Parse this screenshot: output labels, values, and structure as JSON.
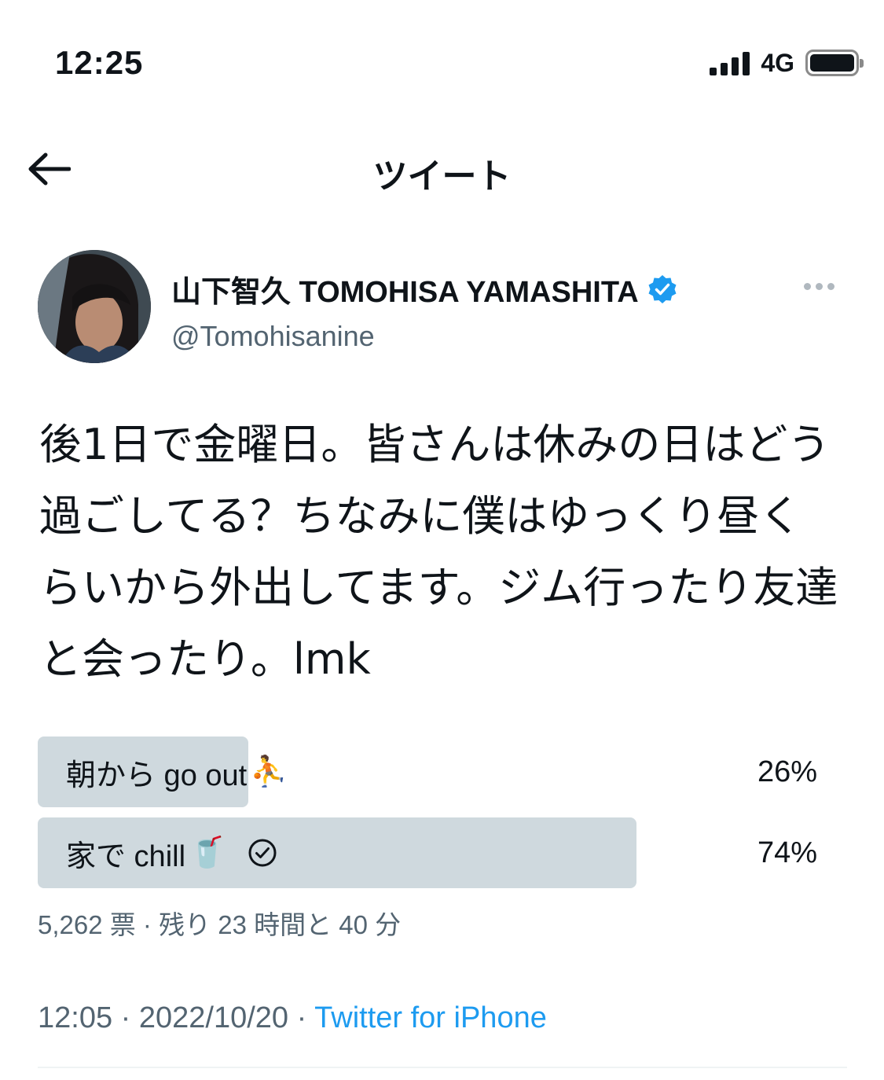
{
  "status_bar": {
    "time": "12:25",
    "network": "4G"
  },
  "nav": {
    "title": "ツイート",
    "back_icon": "arrow-left-icon"
  },
  "tweet": {
    "author": {
      "name": "山下智久 TOMOHISA YAMASHITA",
      "handle": "@Tomohisanine",
      "verified": true
    },
    "text": "後1日で金曜日。皆さんは休みの日はどう過ごしてる？ちなみに僕はゆっくり昼くらいから外出してます。ジム行ったり友達と会ったり。lmk",
    "poll": {
      "options": [
        {
          "label": "朝から go out",
          "emoji": "⛹️",
          "percent": "26%",
          "fraction": 0.26,
          "selected": false
        },
        {
          "label": "家で chill",
          "emoji": "🥤",
          "percent": "74%",
          "fraction": 0.74,
          "selected": true
        }
      ],
      "meta": "5,262 票 · 残り 23 時間と 40 分"
    },
    "time": "12:05",
    "date": "2022/10/20",
    "separator": " · ",
    "source": "Twitter for iPhone"
  },
  "colors": {
    "accent": "#1d9bf0",
    "secondary_text": "#536471",
    "poll_bar": "#cfd9de"
  }
}
